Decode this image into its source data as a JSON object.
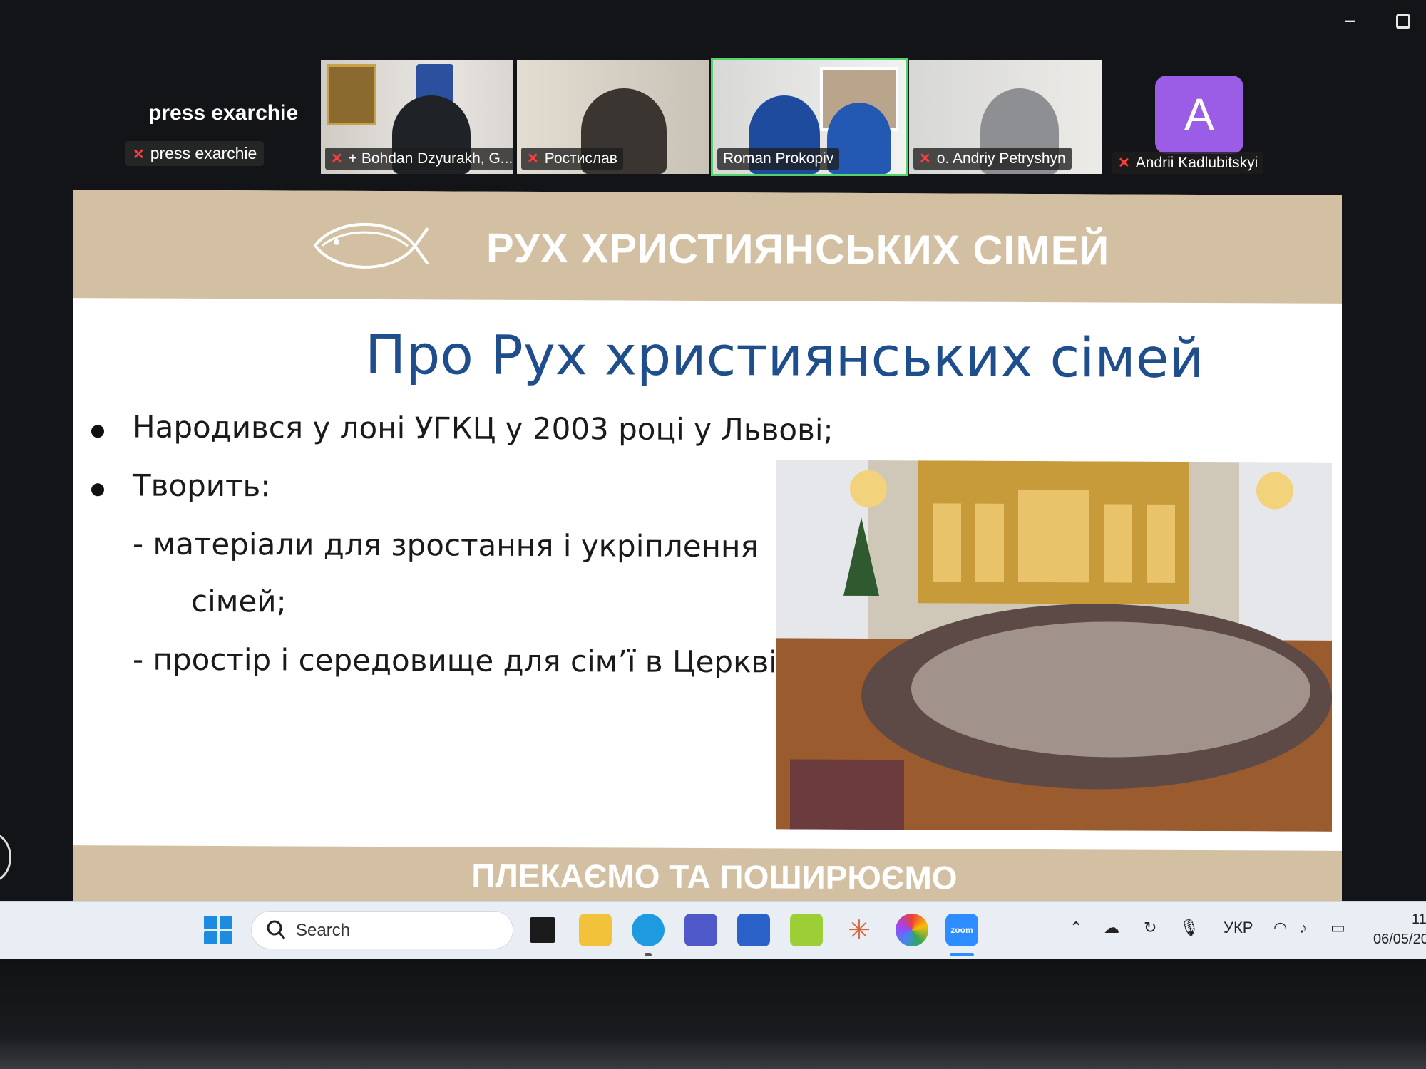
{
  "window": {
    "minimize_label": "–"
  },
  "participants": {
    "self": {
      "name": "press exarchie",
      "tag": "press exarchie"
    },
    "tiles": [
      {
        "name": "+ Bohdan Dzyurakh, G...",
        "muted": true
      },
      {
        "name": "Ростислав",
        "muted": true
      },
      {
        "name": "Roman Prokopiv",
        "muted": false,
        "active": true
      },
      {
        "name": "o. Andriy Petryshyn",
        "muted": true
      },
      {
        "name": "Andrii Kadlubitskyi",
        "muted": true,
        "avatar_letter": "A",
        "avatar_color": "#9b5de5"
      }
    ],
    "mute_icon": "mic-muted-icon"
  },
  "slide": {
    "logo_text": "РУХ ХРИСТИЯНСЬКИХ СІМЕЙ",
    "header_title": "РУХ ХРИСТИЯНСЬКИХ СІМЕЙ",
    "title": "Про Рух християнських сімей",
    "lines": [
      "Народився у лоні УГКЦ у 2003 році у Львові;",
      "Творить:",
      "- матеріали для зростання і укріплення",
      "сімей;",
      "- простір і середовище для сім’ї в Церкві;"
    ],
    "footer": "ПЛЕКАЄМО ТА ПОШИРЮЄМО",
    "colors": {
      "band": "#d3c0a2",
      "title": "#1f4e8c"
    }
  },
  "taskbar": {
    "search_label": "Search",
    "apps": [
      "task-view",
      "file-explorer",
      "edge",
      "teams",
      "microsoft-store",
      "a-app",
      "claude",
      "chrome-like",
      "zoom"
    ],
    "zoom_label": "zoom",
    "tray": {
      "language": "УКР",
      "time": "11",
      "date": "06/05/20"
    }
  }
}
